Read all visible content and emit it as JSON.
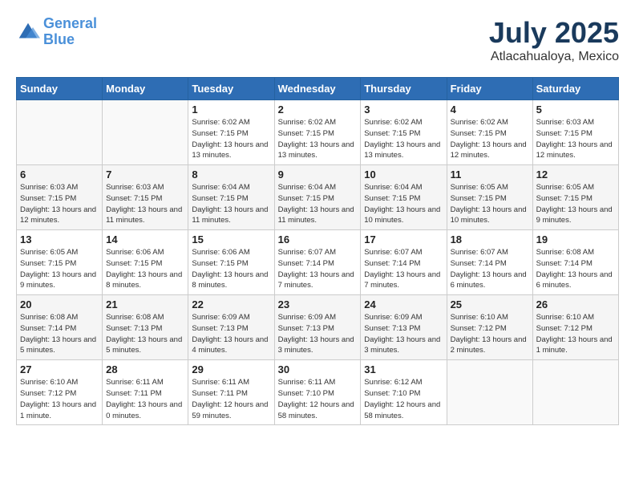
{
  "logo": {
    "line1": "General",
    "line2": "Blue"
  },
  "title": "July 2025",
  "subtitle": "Atlacahualoya, Mexico",
  "header": {
    "days": [
      "Sunday",
      "Monday",
      "Tuesday",
      "Wednesday",
      "Thursday",
      "Friday",
      "Saturday"
    ]
  },
  "weeks": [
    [
      {
        "day": "",
        "info": ""
      },
      {
        "day": "",
        "info": ""
      },
      {
        "day": "1",
        "info": "Sunrise: 6:02 AM\nSunset: 7:15 PM\nDaylight: 13 hours and 13 minutes."
      },
      {
        "day": "2",
        "info": "Sunrise: 6:02 AM\nSunset: 7:15 PM\nDaylight: 13 hours and 13 minutes."
      },
      {
        "day": "3",
        "info": "Sunrise: 6:02 AM\nSunset: 7:15 PM\nDaylight: 13 hours and 13 minutes."
      },
      {
        "day": "4",
        "info": "Sunrise: 6:02 AM\nSunset: 7:15 PM\nDaylight: 13 hours and 12 minutes."
      },
      {
        "day": "5",
        "info": "Sunrise: 6:03 AM\nSunset: 7:15 PM\nDaylight: 13 hours and 12 minutes."
      }
    ],
    [
      {
        "day": "6",
        "info": "Sunrise: 6:03 AM\nSunset: 7:15 PM\nDaylight: 13 hours and 12 minutes."
      },
      {
        "day": "7",
        "info": "Sunrise: 6:03 AM\nSunset: 7:15 PM\nDaylight: 13 hours and 11 minutes."
      },
      {
        "day": "8",
        "info": "Sunrise: 6:04 AM\nSunset: 7:15 PM\nDaylight: 13 hours and 11 minutes."
      },
      {
        "day": "9",
        "info": "Sunrise: 6:04 AM\nSunset: 7:15 PM\nDaylight: 13 hours and 11 minutes."
      },
      {
        "day": "10",
        "info": "Sunrise: 6:04 AM\nSunset: 7:15 PM\nDaylight: 13 hours and 10 minutes."
      },
      {
        "day": "11",
        "info": "Sunrise: 6:05 AM\nSunset: 7:15 PM\nDaylight: 13 hours and 10 minutes."
      },
      {
        "day": "12",
        "info": "Sunrise: 6:05 AM\nSunset: 7:15 PM\nDaylight: 13 hours and 9 minutes."
      }
    ],
    [
      {
        "day": "13",
        "info": "Sunrise: 6:05 AM\nSunset: 7:15 PM\nDaylight: 13 hours and 9 minutes."
      },
      {
        "day": "14",
        "info": "Sunrise: 6:06 AM\nSunset: 7:15 PM\nDaylight: 13 hours and 8 minutes."
      },
      {
        "day": "15",
        "info": "Sunrise: 6:06 AM\nSunset: 7:15 PM\nDaylight: 13 hours and 8 minutes."
      },
      {
        "day": "16",
        "info": "Sunrise: 6:07 AM\nSunset: 7:14 PM\nDaylight: 13 hours and 7 minutes."
      },
      {
        "day": "17",
        "info": "Sunrise: 6:07 AM\nSunset: 7:14 PM\nDaylight: 13 hours and 7 minutes."
      },
      {
        "day": "18",
        "info": "Sunrise: 6:07 AM\nSunset: 7:14 PM\nDaylight: 13 hours and 6 minutes."
      },
      {
        "day": "19",
        "info": "Sunrise: 6:08 AM\nSunset: 7:14 PM\nDaylight: 13 hours and 6 minutes."
      }
    ],
    [
      {
        "day": "20",
        "info": "Sunrise: 6:08 AM\nSunset: 7:14 PM\nDaylight: 13 hours and 5 minutes."
      },
      {
        "day": "21",
        "info": "Sunrise: 6:08 AM\nSunset: 7:13 PM\nDaylight: 13 hours and 5 minutes."
      },
      {
        "day": "22",
        "info": "Sunrise: 6:09 AM\nSunset: 7:13 PM\nDaylight: 13 hours and 4 minutes."
      },
      {
        "day": "23",
        "info": "Sunrise: 6:09 AM\nSunset: 7:13 PM\nDaylight: 13 hours and 3 minutes."
      },
      {
        "day": "24",
        "info": "Sunrise: 6:09 AM\nSunset: 7:13 PM\nDaylight: 13 hours and 3 minutes."
      },
      {
        "day": "25",
        "info": "Sunrise: 6:10 AM\nSunset: 7:12 PM\nDaylight: 13 hours and 2 minutes."
      },
      {
        "day": "26",
        "info": "Sunrise: 6:10 AM\nSunset: 7:12 PM\nDaylight: 13 hours and 1 minute."
      }
    ],
    [
      {
        "day": "27",
        "info": "Sunrise: 6:10 AM\nSunset: 7:12 PM\nDaylight: 13 hours and 1 minute."
      },
      {
        "day": "28",
        "info": "Sunrise: 6:11 AM\nSunset: 7:11 PM\nDaylight: 13 hours and 0 minutes."
      },
      {
        "day": "29",
        "info": "Sunrise: 6:11 AM\nSunset: 7:11 PM\nDaylight: 12 hours and 59 minutes."
      },
      {
        "day": "30",
        "info": "Sunrise: 6:11 AM\nSunset: 7:10 PM\nDaylight: 12 hours and 58 minutes."
      },
      {
        "day": "31",
        "info": "Sunrise: 6:12 AM\nSunset: 7:10 PM\nDaylight: 12 hours and 58 minutes."
      },
      {
        "day": "",
        "info": ""
      },
      {
        "day": "",
        "info": ""
      }
    ]
  ]
}
